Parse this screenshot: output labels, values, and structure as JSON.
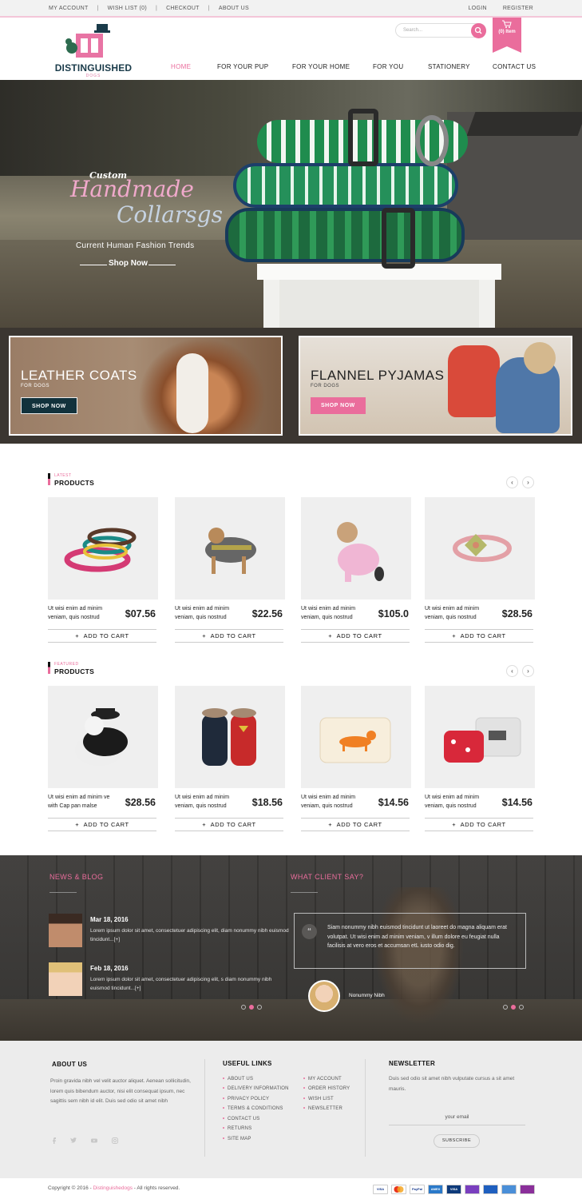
{
  "topbar": {
    "left": [
      "MY ACCOUNT",
      "WISH LIST (0)",
      "CHECKOUT",
      "ABOUT US"
    ],
    "right": [
      "LOGIN",
      "REGISTER"
    ]
  },
  "header": {
    "brand": "DISTINGUISHED",
    "brand_sub": "DOGS",
    "search_placeholder": "Search...",
    "cart_label": "(0) Item"
  },
  "nav": [
    "HOME",
    "FOR YOUR PUP",
    "FOR YOUR HOME",
    "FOR YOU",
    "STATIONERY",
    "CONTACT US"
  ],
  "hero": {
    "line1": "Custom",
    "line2": "Handmade",
    "line3": "Collarsgs",
    "subtitle": "Current Human Fashion Trends",
    "cta": "Shop Now"
  },
  "promos": [
    {
      "title": "LEATHER COATS",
      "sub": "FOR DOGS",
      "button": "SHOP NOW"
    },
    {
      "title": "FLANNEL PYJAMAS",
      "sub": "FOR DOGS",
      "button": "SHOP NOW"
    }
  ],
  "latest": {
    "label": "LATEST",
    "title": "PRODUCTS",
    "items": [
      {
        "desc": "Ut wisi enim ad minim veniam, quis nostrud",
        "price": "$07.56",
        "button": "ADD TO CART"
      },
      {
        "desc": "Ut wisi enim ad minim veniam, quis nostrud",
        "price": "$22.56",
        "button": "ADD TO CART"
      },
      {
        "desc": "Ut wisi enim ad minim veniam, quis nostrud",
        "price": "$105.0",
        "button": "ADD TO CART"
      },
      {
        "desc": "Ut wisi enim ad minim veniam, quis nostrud",
        "price": "$28.56",
        "button": "ADD TO CART"
      }
    ]
  },
  "featured": {
    "label": "FEATURED",
    "title": "PRODUCTS",
    "items": [
      {
        "desc": "Ut wisi enim ad minim ve with Cap pan malse",
        "price": "$28.56",
        "button": "ADD TO CART"
      },
      {
        "desc": "Ut wisi enim ad minim veniam, quis nostrud",
        "price": "$18.56",
        "button": "ADD TO CART"
      },
      {
        "desc": "Ut wisi enim ad minim veniam, quis nostrud",
        "price": "$14.56",
        "button": "ADD TO CART"
      },
      {
        "desc": "Ut wisi enim ad minim veniam, quis nostrud",
        "price": "$14.56",
        "button": "ADD TO CART"
      }
    ]
  },
  "news": {
    "title": "NEWS & BLOG",
    "posts": [
      {
        "date": "Mar 18, 2016",
        "text": "Lorem ipsum dolor sit amet, consectetuer adipiscing elit,  diam nonummy nibh euismod tincidunt...[+]"
      },
      {
        "date": "Feb 18, 2016",
        "text": "Lorem ipsum dolor sit amet, consectetuer adipiscing elit, s diam nonummy nibh euismod tincidunt...[+]"
      }
    ]
  },
  "testimonial": {
    "title": "WHAT CLIENT SAY?",
    "quote": "Siam nonummy nibh euismod tincidunt ut laoreet do magna aliquam erat volutpat. Ut wisi enim ad minim veniam,  v illum dolore eu feugiat nulla facilisis at vero eros et accumsan etL iusto odio dig.",
    "author": "Nonummy Nibh"
  },
  "footer": {
    "about_title": "ABOUT US",
    "about_text": "Proin gravida nibh vel velit auctor aliquet. Aenean sollicitudin, lorem quis bibendum auctor, nisi elit consequat ipsum, nec sagittis sem nibh id elit. Duis sed odio sit amet nibh",
    "links_title": "USEFUL LINKS",
    "links_col1": [
      "ABOUT US",
      "DELIVERY INFORMATION",
      "PRIVACY POLICY",
      "TERMS & CONDITIONS",
      "CONTACT US",
      "RETURNS",
      "SITE MAP"
    ],
    "links_col2": [
      "MY ACCOUNT",
      "ORDER HISTORY",
      "WISH LIST",
      "NEWSLETTER"
    ],
    "newsletter_title": "NEWSLETTER",
    "newsletter_text": "Duis sed odio sit amet nibh vulputate cursus a sit amet mauris.",
    "email_placeholder": "your email",
    "subscribe": "SUBSCRIBE",
    "social_icons": [
      "facebook-icon",
      "twitter-icon",
      "youtube-icon",
      "instagram-icon"
    ]
  },
  "bottom": {
    "copy_pre": "Copyright © 2016 - ",
    "copy_brand": "Distinguishedogs",
    "copy_post": " - All rights reserved.",
    "payments": [
      {
        "name": "VISA",
        "color": "#1a3d8f"
      },
      {
        "name": "MC",
        "color": "#e8341c"
      },
      {
        "name": "PayPal",
        "color": "#ffffff"
      },
      {
        "name": "AMEX",
        "color": "#2a79c9"
      },
      {
        "name": "VISA",
        "color": "#0d3a7a"
      },
      {
        "name": "",
        "color": "#7a3fbf"
      },
      {
        "name": "",
        "color": "#1f5fbf"
      },
      {
        "name": "",
        "color": "#4a8fd8"
      },
      {
        "name": "",
        "color": "#8a2f9a"
      }
    ]
  },
  "colors": {
    "accent": "#ea6d9c",
    "navy": "#1a3b4a",
    "teal_btn": "#12323c"
  }
}
